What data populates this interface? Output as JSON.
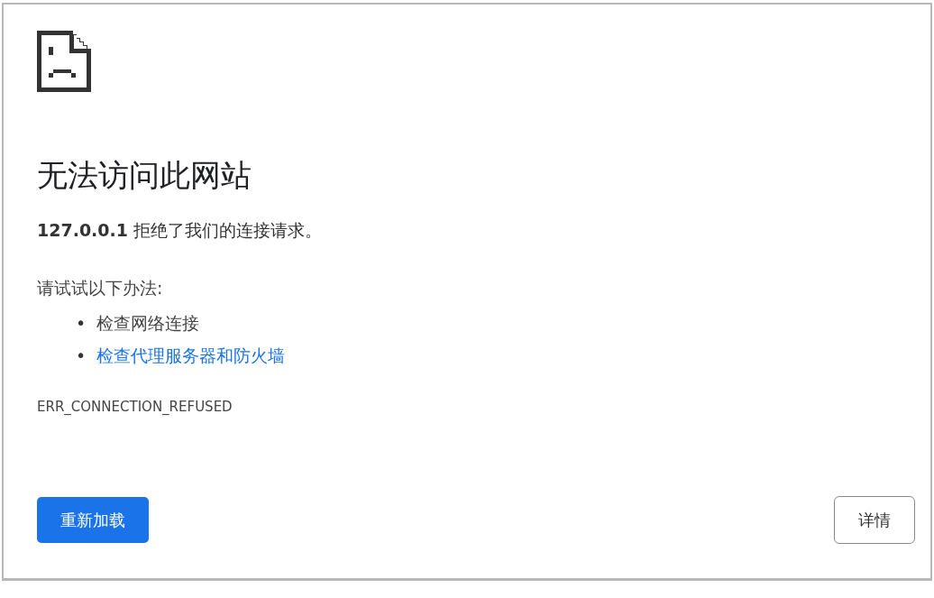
{
  "error_page": {
    "title": "无法访问此网站",
    "message": "**127.0.0.1** 拒绝了我们的连接请求。",
    "suggestions_heading": "请试试以下办法:",
    "suggestions": [
      {
        "kind": "text",
        "bullet": "•",
        "text": "检查网络连接"
      },
      {
        "kind": "link",
        "bullet": "•",
        "text": "检查代理服务器和防火墙"
      }
    ],
    "error_code": "ERR_CONNECTION_REFUSED",
    "buttons": [
      {
        "kind": "primary",
        "label": "重新加载"
      },
      {
        "kind": "secondary",
        "label": "详情"
      }
    ]
  }
}
